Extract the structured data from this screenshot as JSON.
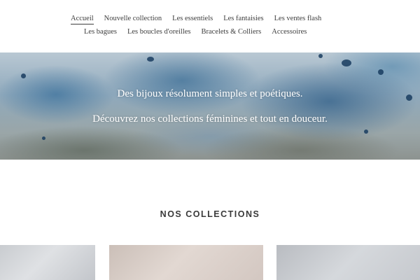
{
  "nav": {
    "row1": [
      "Accueil",
      "Nouvelle collection",
      "Les essentiels",
      "Les fantaisies",
      "Les ventes flash"
    ],
    "row2": [
      "Les bagues",
      "Les boucles d'oreilles",
      "Bracelets & Colliers",
      "Accessoires"
    ]
  },
  "hero": {
    "line1": "Des bijoux résolument simples et poétiques.",
    "line2": "Découvrez nos collections féminines et tout en douceur."
  },
  "collections": {
    "title": "NOS COLLECTIONS"
  },
  "colors": {
    "text": "#3d3d3d",
    "hero_text": "#ffffff",
    "background": "#ffffff"
  }
}
